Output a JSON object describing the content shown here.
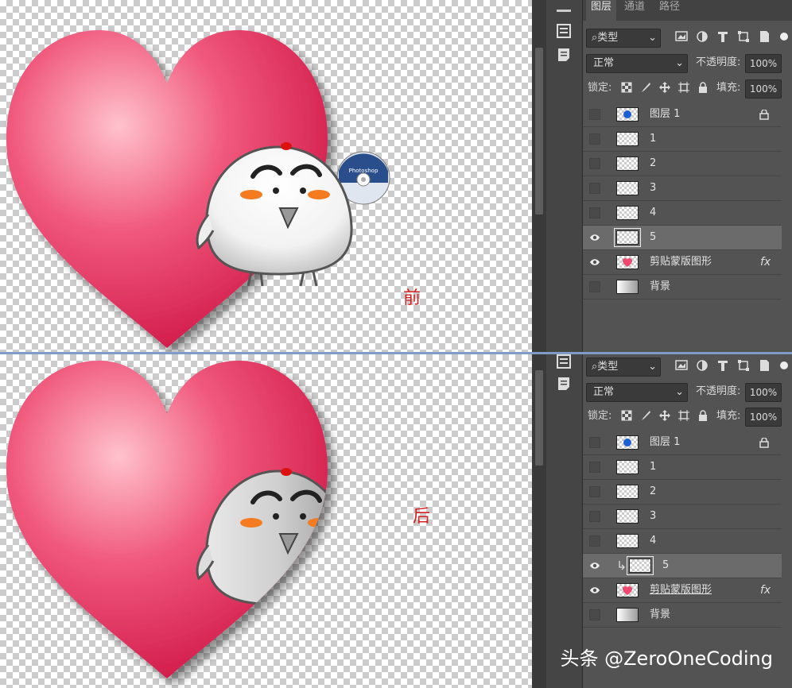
{
  "captions": {
    "before": "前",
    "after": "后"
  },
  "tabs": [
    {
      "label": "图层"
    },
    {
      "label": "通道"
    },
    {
      "label": "路径"
    }
  ],
  "filter": {
    "kind": "类型"
  },
  "blend_mode": "正常",
  "opacity": {
    "label": "不透明度:",
    "value": "100%"
  },
  "lock": {
    "label": "锁定:"
  },
  "fill": {
    "label": "填充:",
    "value": "100%"
  },
  "disc_text": "Photoshop",
  "layers_before": [
    {
      "name": "图层 1",
      "visible": false,
      "locked": true
    },
    {
      "name": "1",
      "visible": false
    },
    {
      "name": "2",
      "visible": false
    },
    {
      "name": "3",
      "visible": false
    },
    {
      "name": "4",
      "visible": false
    },
    {
      "name": "5",
      "visible": true,
      "selected": true
    },
    {
      "name": "剪贴蒙版图形",
      "visible": true,
      "fx": "fx"
    },
    {
      "name": "背景",
      "visible": false
    }
  ],
  "layers_after": [
    {
      "name": "图层 1",
      "visible": false,
      "locked": true
    },
    {
      "name": "1",
      "visible": false
    },
    {
      "name": "2",
      "visible": false
    },
    {
      "name": "3",
      "visible": false
    },
    {
      "name": "4",
      "visible": false
    },
    {
      "name": "5",
      "visible": true,
      "selected": true,
      "clipped": true
    },
    {
      "name": "剪贴蒙版图形",
      "visible": true,
      "fx": "fx"
    },
    {
      "name": "背景",
      "visible": false
    }
  ],
  "watermark": "头条 @ZeroOneCoding",
  "colors": {
    "heart": "#f0486f",
    "panel": "#535353",
    "caption": "#d42020",
    "selected_row": "#6b6b6b"
  }
}
